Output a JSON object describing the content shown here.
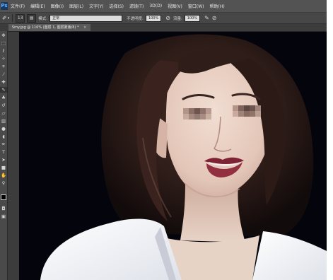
{
  "menu": {
    "logo": "Ps",
    "items": [
      "文件(F)",
      "编辑(E)",
      "图像(I)",
      "图层(L)",
      "文字(Y)",
      "选择(S)",
      "滤镜(T)",
      "3D(D)",
      "视图(V)",
      "窗口(W)",
      "帮助(H)"
    ]
  },
  "options": {
    "brush_size": "13",
    "mode_label": "模式:",
    "mode_value": "正常",
    "opacity_label": "不透明度:",
    "opacity_value": "100%",
    "flow_label": "流量:",
    "flow_value": "100%"
  },
  "document": {
    "tab_title": "Smy.jpg @ 116% (图层 1, 图层蒙版/8) *",
    "close_glyph": "×"
  },
  "toolbox": {
    "tools": [
      "move-icon",
      "marquee-icon",
      "lasso-icon",
      "quick-select-icon",
      "crop-icon",
      "eyedropper-icon",
      "healing-icon",
      "brush-icon",
      "clone-stamp-icon",
      "history-brush-icon",
      "eraser-icon",
      "gradient-icon",
      "blur-icon",
      "dodge-icon",
      "pen-icon",
      "type-icon",
      "path-select-icon",
      "shape-icon",
      "hand-icon",
      "zoom-icon"
    ]
  },
  "colors": {
    "menubar": "#535353",
    "optionsbar": "#474747",
    "workspace": "#2b2b2b",
    "photo_background": "#04040c",
    "hair": "#2a1a17",
    "skin": "#e9d2c6",
    "lips": "#8c2a3a",
    "blazer": "#f4f5f8"
  }
}
